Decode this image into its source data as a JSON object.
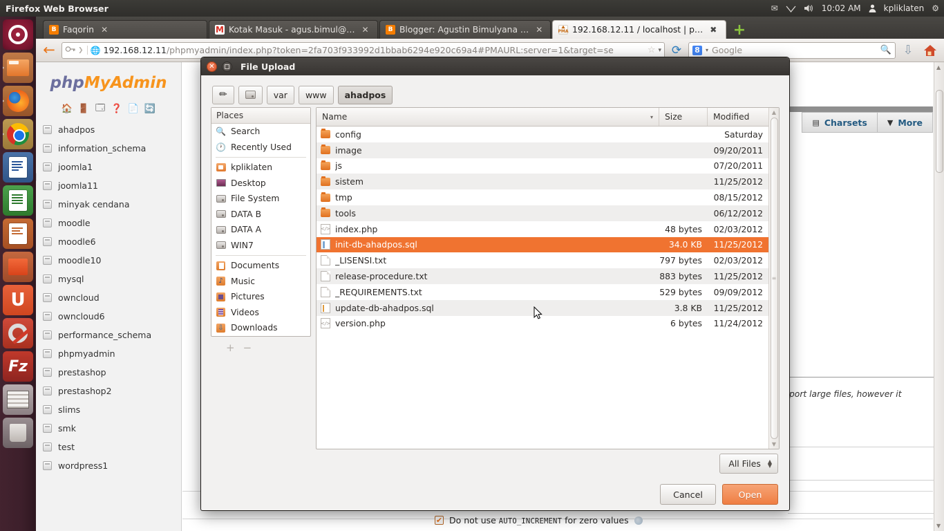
{
  "desktop": {
    "top_panel": {
      "app_title": "Firefox Web Browser",
      "indicators": {
        "mail": "✉",
        "network": "wifi-icon",
        "volume": "🔊",
        "clock": "10:02 AM",
        "user": "kpliklaten",
        "gear": "⚙"
      }
    },
    "launcher": {
      "items": [
        {
          "name": "ubuntu-dash",
          "label": "Dash Home"
        },
        {
          "name": "files",
          "label": "Files"
        },
        {
          "name": "firefox",
          "label": "Firefox Web Browser"
        },
        {
          "name": "chrome",
          "label": "Google Chrome"
        },
        {
          "name": "libreoffice-writer",
          "label": "LibreOffice Writer"
        },
        {
          "name": "libreoffice-calc",
          "label": "LibreOffice Calc"
        },
        {
          "name": "libreoffice-impress",
          "label": "LibreOffice Impress"
        },
        {
          "name": "software-center",
          "label": "Ubuntu Software Center"
        },
        {
          "name": "ubuntu-one",
          "label": "Ubuntu One"
        },
        {
          "name": "system-settings",
          "label": "System Settings"
        },
        {
          "name": "filezilla",
          "label": "FileZilla"
        },
        {
          "name": "workspace-switcher",
          "label": "Workspace Switcher"
        },
        {
          "name": "trash",
          "label": "Trash"
        }
      ]
    }
  },
  "browser": {
    "tabs": [
      {
        "title": "Faqorin",
        "favicon": "blogger-icon",
        "active": false,
        "close": "✕"
      },
      {
        "title": "Kotak Masuk - agus.bimul@…",
        "favicon": "gmail-icon",
        "active": false,
        "close": "✕"
      },
      {
        "title": "Blogger: Agustin Bimulyana …",
        "favicon": "blogger-icon",
        "active": false,
        "close": "✕"
      },
      {
        "title": "192.168.12.11 / localhost | p…",
        "favicon": "phpmyadmin-icon",
        "active": true,
        "close": "✖"
      }
    ],
    "new_tab_label": "+",
    "toolbar": {
      "back_label": "←",
      "url_host": "192.168.12.11",
      "url_rest": "/phpmyadmin/index.php?token=2fa703f933992d1bbab6294e920c69a4#PMAURL:server=1&target=se",
      "star": "☆",
      "dropdown": "▾",
      "reload": "⟳",
      "search_engine": "8",
      "search_placeholder": "Google",
      "search_value": "",
      "search_icon": "search-icon",
      "downloads_icon": "⇩",
      "home_icon": "home-icon"
    }
  },
  "phpmyadmin": {
    "logo": {
      "part1": "php",
      "part2": "MyAdmin"
    },
    "quick_icons": [
      "home-icon",
      "logout-icon",
      "sql-window-icon",
      "help-icon",
      "docs-icon",
      "reload-icon"
    ],
    "databases": [
      "ahadpos",
      "information_schema",
      "joomla1",
      "joomla11",
      "minyak cendana",
      "moodle",
      "moodle6",
      "moodle10",
      "mysql",
      "owncloud",
      "owncloud6",
      "performance_schema",
      "phpmyadmin",
      "prestashop",
      "prestashop2",
      "slims",
      "smk",
      "test",
      "wordpress1"
    ],
    "tabs": [
      {
        "label": "Charsets",
        "icon": "charsets-icon"
      },
      {
        "label": "More",
        "icon": "chevron-down-icon"
      }
    ],
    "note_text": "port large files, however it",
    "checkbox": {
      "checked": "✔",
      "text_before": "Do not use ",
      "text_mono": "AUTO_INCREMENT",
      "text_after": " for zero values",
      "help": "help-icon"
    }
  },
  "dialog": {
    "title": "File Upload",
    "window_buttons": {
      "close": "✕",
      "maximize": "□"
    },
    "pathbar": {
      "edit_icon": "pencil-icon",
      "root_icon": "filesystem-icon",
      "crumbs": [
        {
          "label": "var",
          "current": false
        },
        {
          "label": "www",
          "current": false
        },
        {
          "label": "ahadpos",
          "current": true
        }
      ]
    },
    "places": {
      "header": "Places",
      "groups": [
        [
          {
            "label": "Search",
            "icon": "search-icon"
          },
          {
            "label": "Recently Used",
            "icon": "recent-icon"
          }
        ],
        [
          {
            "label": "kpliklaten",
            "icon": "home-folder-icon"
          },
          {
            "label": "Desktop",
            "icon": "desktop-icon"
          },
          {
            "label": "File System",
            "icon": "drive-icon"
          },
          {
            "label": "DATA B",
            "icon": "drive-icon"
          },
          {
            "label": "DATA A",
            "icon": "drive-icon"
          },
          {
            "label": "WIN7",
            "icon": "drive-icon"
          }
        ],
        [
          {
            "label": "Documents",
            "icon": "documents-icon"
          },
          {
            "label": "Music",
            "icon": "music-icon"
          },
          {
            "label": "Pictures",
            "icon": "pictures-icon"
          },
          {
            "label": "Videos",
            "icon": "videos-icon"
          },
          {
            "label": "Downloads",
            "icon": "downloads-icon"
          }
        ]
      ],
      "add_button": "+",
      "remove_button": "−"
    },
    "filelist": {
      "columns": {
        "name": "Name",
        "size": "Size",
        "modified": "Modified"
      },
      "sort_caret": "▾",
      "rows": [
        {
          "name": "config",
          "size": "",
          "modified": "Saturday",
          "type": "folder",
          "selected": false
        },
        {
          "name": "image",
          "size": "",
          "modified": "09/20/2011",
          "type": "folder",
          "selected": false
        },
        {
          "name": "js",
          "size": "",
          "modified": "07/20/2011",
          "type": "folder",
          "selected": false
        },
        {
          "name": "sistem",
          "size": "",
          "modified": "11/25/2012",
          "type": "folder",
          "selected": false
        },
        {
          "name": "tmp",
          "size": "",
          "modified": "08/15/2012",
          "type": "folder",
          "selected": false
        },
        {
          "name": "tools",
          "size": "",
          "modified": "06/12/2012",
          "type": "folder",
          "selected": false
        },
        {
          "name": "index.php",
          "size": "48 bytes",
          "modified": "02/03/2012",
          "type": "php",
          "selected": false
        },
        {
          "name": "init-db-ahadpos.sql",
          "size": "34.0 KB",
          "modified": "11/25/2012",
          "type": "sql",
          "selected": true
        },
        {
          "name": "_LISENSI.txt",
          "size": "797 bytes",
          "modified": "02/03/2012",
          "type": "txt",
          "selected": false
        },
        {
          "name": "release-procedure.txt",
          "size": "883 bytes",
          "modified": "11/25/2012",
          "type": "txt",
          "selected": false
        },
        {
          "name": "_REQUIREMENTS.txt",
          "size": "529 bytes",
          "modified": "09/09/2012",
          "type": "txt",
          "selected": false
        },
        {
          "name": "update-db-ahadpos.sql",
          "size": "3.8 KB",
          "modified": "11/25/2012",
          "type": "sql2",
          "selected": false
        },
        {
          "name": "version.php",
          "size": "6 bytes",
          "modified": "11/24/2012",
          "type": "php",
          "selected": false
        }
      ]
    },
    "filter": {
      "label": "All Files",
      "spinner": "⇕"
    },
    "buttons": {
      "cancel": "Cancel",
      "open": "Open"
    }
  }
}
